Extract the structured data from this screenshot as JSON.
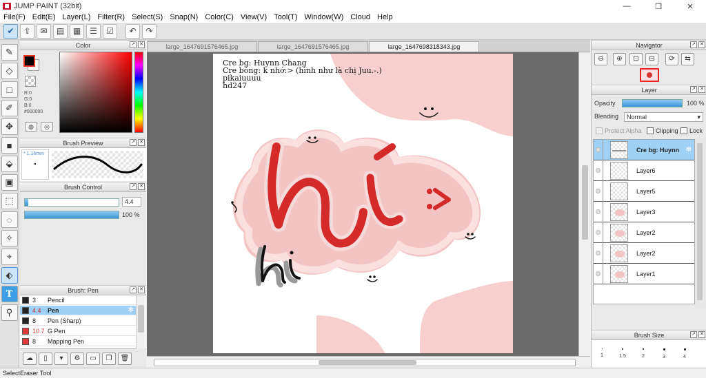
{
  "window": {
    "title": "JUMP PAINT (32bit)",
    "controls": [
      "—",
      "❐",
      "✕"
    ]
  },
  "menu": [
    "File(F)",
    "Edit(E)",
    "Layer(L)",
    "Filter(R)",
    "Select(S)",
    "Snap(N)",
    "Color(C)",
    "View(V)",
    "Tool(T)",
    "Window(W)",
    "Cloud",
    "Help"
  ],
  "tabs": [
    "large_1647691576465.jpg",
    "large_1647691576465.jpg",
    "large_1647698318343.jpg"
  ],
  "active_tab": 2,
  "color_panel": {
    "title": "Color",
    "r": "R:0",
    "g": "G:0",
    "b": "B:0",
    "hex": "#000000",
    "foreground": "#000000",
    "background": "#ffffff"
  },
  "brush_preview": {
    "title": "Brush Preview",
    "size": "1.16mm"
  },
  "brush_control": {
    "title": "Brush Control",
    "size_value": "4.4",
    "size_fraction": 0.04,
    "opacity_value": "100 %",
    "opacity_fraction": 1.0
  },
  "brush_list": {
    "title": "Brush: Pen",
    "items": [
      {
        "size": "3",
        "name": "Pencil",
        "color": "#222222",
        "selected": false,
        "red": false
      },
      {
        "size": "4.4",
        "name": "Pen",
        "color": "#222222",
        "selected": true,
        "red": true
      },
      {
        "size": "8",
        "name": "Pen (Sharp)",
        "color": "#222222",
        "selected": false,
        "red": false
      },
      {
        "size": "10.7",
        "name": "G Pen",
        "color": "#e03a3a",
        "selected": false,
        "red": true
      },
      {
        "size": "8",
        "name": "Mapping Pen",
        "color": "#e03a3a",
        "selected": false,
        "red": false
      }
    ]
  },
  "canvas": {
    "credits": [
      "Cre bg: Huynn Chang",
      "Cre bóng: k nhớ:> (hình như là chị Juu.-.)",
      "pikaiuuuu",
      "hd247"
    ],
    "art_text_main": "hí",
    "art_text_small": "hi",
    "art_text_side": ":>"
  },
  "navigator": {
    "title": "Navigator"
  },
  "layer_panel": {
    "title": "Layer",
    "opacity_label": "Opacity",
    "opacity_value": "100 %",
    "blending_label": "Blending",
    "blending_value": "Normal",
    "protect_alpha": "Protect Alpha",
    "clipping": "Clipping",
    "lock": "Lock",
    "layers": [
      {
        "name": "Cre bg: Huynn",
        "selected": true,
        "thumb": "text"
      },
      {
        "name": "Layer6",
        "selected": false,
        "thumb": "empty"
      },
      {
        "name": "Layer5",
        "selected": false,
        "thumb": "empty"
      },
      {
        "name": "Layer3",
        "selected": false,
        "thumb": "pink"
      },
      {
        "name": "Layer2",
        "selected": false,
        "thumb": "pink"
      },
      {
        "name": "Layer2",
        "selected": false,
        "thumb": "pink"
      },
      {
        "name": "Layer1",
        "selected": false,
        "thumb": "pink"
      }
    ]
  },
  "brush_size": {
    "title": "Brush Size",
    "sizes": [
      "1",
      "1.5",
      "2",
      "3",
      "4"
    ]
  },
  "status": "SelectEraser Tool",
  "colors": {
    "accent": "#3a95d8",
    "selection": "#9fd0f5",
    "canvas_bg": "#6b6b6b",
    "pink": "#f8cfcf",
    "red_stroke": "#d42a2a"
  }
}
